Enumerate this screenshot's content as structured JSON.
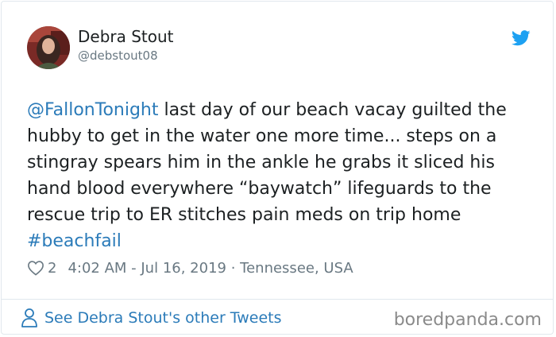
{
  "tweet": {
    "author_name": "Debra Stout",
    "author_handle": "@debstout08",
    "mention": "@FallonTonight",
    "text_main": " last day of our beach vacay guilted the hubby to get in the water one more time... steps on a stingray spears him in the ankle he grabs it sliced his hand blood everywhere “baywatch” lifeguards to the rescue trip to ER stitches pain meds on trip home ",
    "hashtag": "#beachfail",
    "likes": "2",
    "timestamp": "4:02 AM - Jul 16, 2019",
    "separator": " · ",
    "location": "Tennessee, USA"
  },
  "footer": {
    "other_tweets_label": "See Debra Stout's other Tweets"
  },
  "watermark": "boredpanda.com",
  "icons": {
    "twitter": "twitter-bird-icon",
    "like": "heart-icon",
    "profile": "person-icon"
  },
  "colors": {
    "link": "#2b7bb9",
    "twitter_blue": "#1da1f2",
    "text": "#1c2022",
    "muted": "#697882"
  }
}
